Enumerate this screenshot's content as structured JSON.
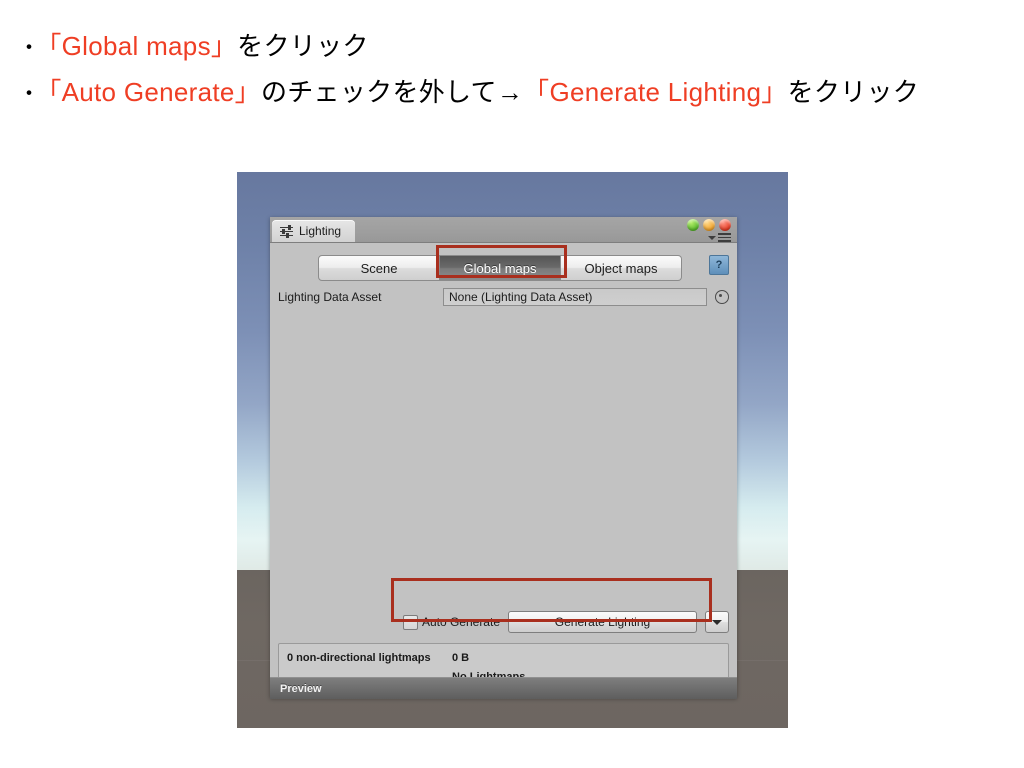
{
  "instructions": {
    "line1": {
      "bullet": "・",
      "highlight": "「Global maps」",
      "rest": "をクリック"
    },
    "line2": {
      "bullet": "・",
      "highlight_a": "「Auto Generate」",
      "mid": "のチェックを外して→",
      "highlight_b": "「Generate Lighting」",
      "rest": "をクリック"
    },
    "highlight_color": "#ef3e24",
    "text_color": "#000000"
  },
  "window": {
    "tab_label": "Lighting",
    "tab_icon": "sliders-icon",
    "controls": [
      {
        "name": "minimize",
        "color": "#57b92a"
      },
      {
        "name": "maximize",
        "color": "#f0a22a"
      },
      {
        "name": "close",
        "color": "#e43a23"
      }
    ],
    "menu_icon": "hamburger-menu-icon",
    "help_icon": "help-book-icon",
    "help_glyph": "?"
  },
  "tabs": [
    {
      "label": "Scene",
      "active": false
    },
    {
      "label": "Global maps",
      "active": true
    },
    {
      "label": "Object maps",
      "active": false
    }
  ],
  "property": {
    "label": "Lighting Data Asset",
    "value": "None (Lighting Data Asset)",
    "picker_icon": "object-picker-icon"
  },
  "actions": {
    "auto_generate_label": "Auto Generate",
    "auto_generate_checked": false,
    "generate_button_label": "Generate Lighting",
    "dropdown_icon": "chevron-down-icon"
  },
  "stats": {
    "rows": [
      {
        "left": "0 non-directional lightmaps",
        "right": "0 B"
      },
      {
        "left": "",
        "right": "No Lightmaps"
      }
    ]
  },
  "preview": {
    "label": "Preview"
  },
  "annotations": {
    "color": "#a92f1e",
    "boxes": [
      {
        "target": "global-maps-tab"
      },
      {
        "target": "generate-lighting-row"
      }
    ]
  }
}
